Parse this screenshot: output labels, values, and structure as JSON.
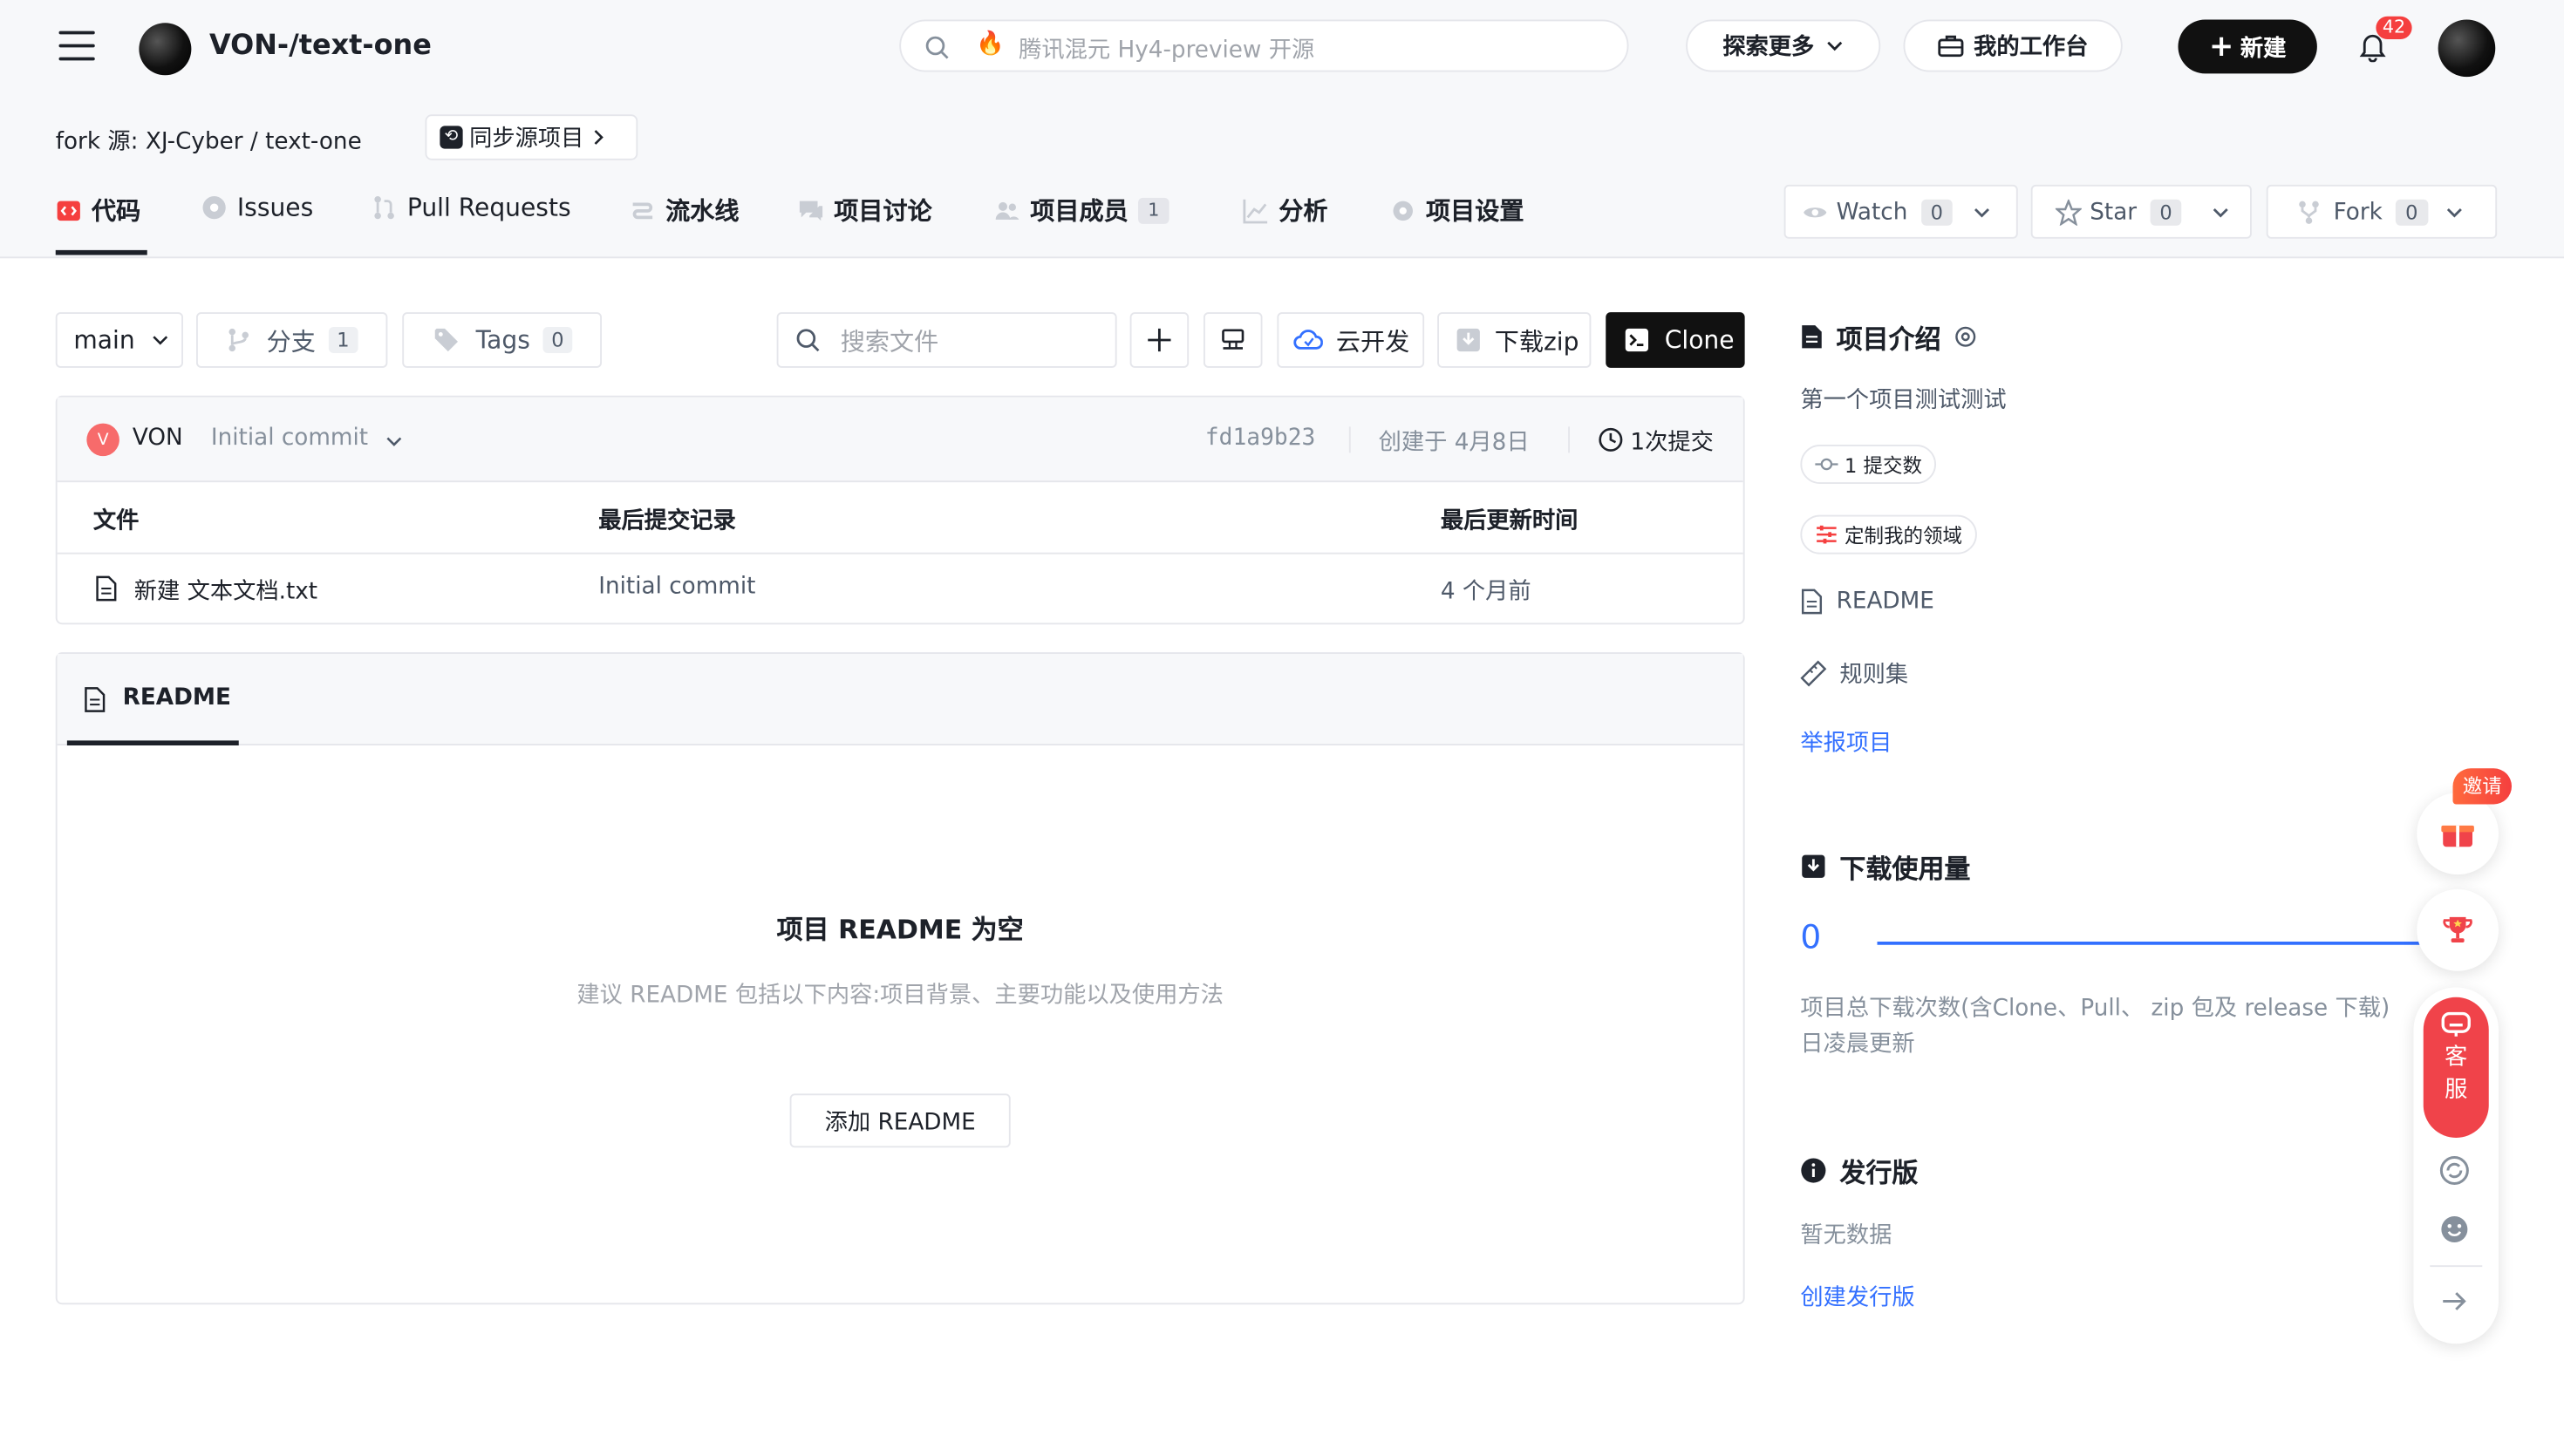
{
  "header": {
    "repo_title": "VON-/text-one",
    "search_placeholder": "腾讯混元 Hy4-preview 开源",
    "explore_label": "探索更多",
    "workbench_label": "我的工作台",
    "new_label": "新建",
    "notification_count": "42"
  },
  "fork": {
    "prefix": "fork 源:",
    "source": "XJ-Cyber / text-one",
    "sync_label": "同步源项目"
  },
  "tabs": [
    {
      "label": "代码",
      "badge": ""
    },
    {
      "label": "Issues",
      "badge": ""
    },
    {
      "label": "Pull Requests",
      "badge": ""
    },
    {
      "label": "流水线",
      "badge": ""
    },
    {
      "label": "项目讨论",
      "badge": ""
    },
    {
      "label": "项目成员",
      "badge": "1"
    },
    {
      "label": "分析",
      "badge": ""
    },
    {
      "label": "项目设置",
      "badge": ""
    }
  ],
  "social": {
    "watch_label": "Watch",
    "watch_count": "0",
    "star_label": "Star",
    "star_count": "0",
    "fork_label": "Fork",
    "fork_count": "0"
  },
  "toolbar": {
    "branch": "main",
    "branches_label": "分支",
    "branches_count": "1",
    "tags_label": "Tags",
    "tags_count": "0",
    "search_placeholder": "搜索文件",
    "cloud_dev_label": "云开发",
    "download_label": "下载zip",
    "clone_label": "Clone"
  },
  "commit": {
    "author_initial": "V",
    "author": "VON",
    "message": "Initial commit",
    "hash": "fd1a9b23",
    "created": "创建于 4月8日",
    "commits": "1次提交"
  },
  "files": {
    "headers": [
      "文件",
      "最后提交记录",
      "最后更新时间"
    ],
    "rows": [
      {
        "name": "新建 文本文档.txt",
        "commit": "Initial commit",
        "time": "4 个月前"
      }
    ]
  },
  "readme": {
    "tab_label": "README",
    "empty_title": "项目 README 为空",
    "empty_desc": "建议 README 包括以下内容:项目背景、主要功能以及使用方法",
    "add_label": "添加 README"
  },
  "sidebar": {
    "intro_title": "项目介绍",
    "intro_desc": "第一个项目测试测试",
    "commits_chip": "1 提交数",
    "domain_chip": "定制我的领域",
    "readme_link": "README",
    "rules_link": "规则集",
    "report_link": "举报项目",
    "downloads_title": "下载使用量",
    "downloads_value": "0",
    "downloads_desc_1": "项目总下载次数(含Clone、Pull、 zip 包及 release 下载)",
    "downloads_desc_2": "日凌晨更新",
    "release_title": "发行版",
    "release_empty": "暂无数据",
    "release_create": "创建发行版"
  },
  "floating": {
    "invite_label": "邀请",
    "service_label_1": "客",
    "service_label_2": "服"
  }
}
